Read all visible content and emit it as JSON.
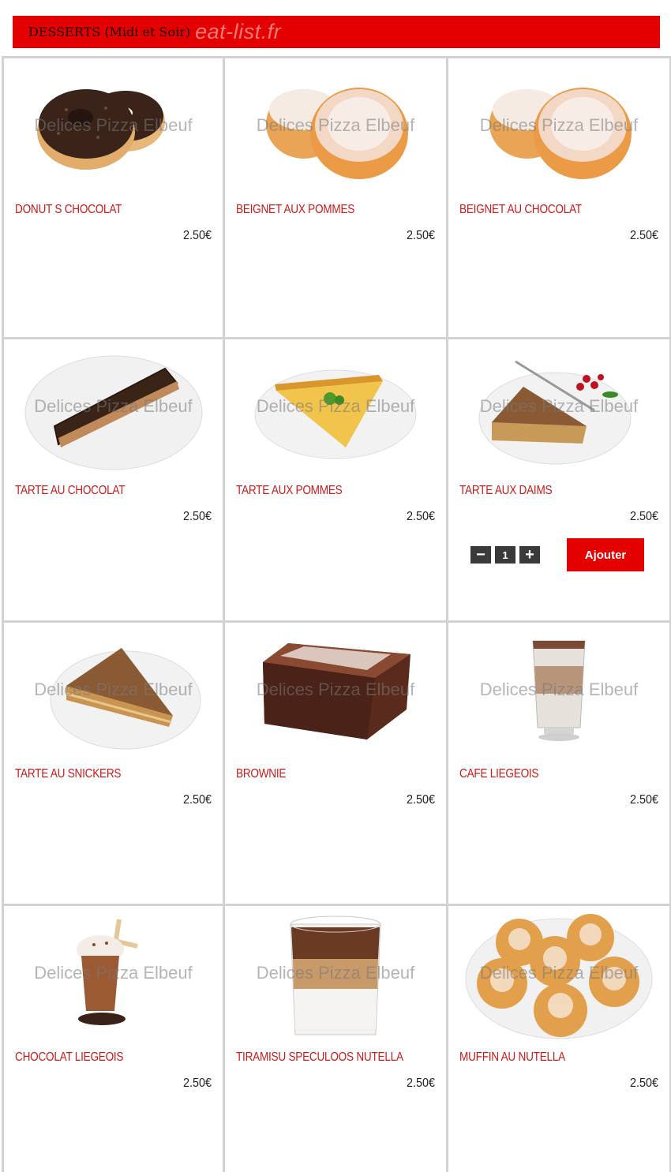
{
  "header": {
    "title": "DESSERTS (Midi et Soir)",
    "watermark": "eat-list.fr"
  },
  "watermark_text": "Delices Pizza Elbeuf",
  "products": [
    {
      "name": "DONUT S CHOCOLAT",
      "price": "2.50€",
      "image": "donut-chocolate"
    },
    {
      "name": "BEIGNET AUX POMMES",
      "price": "2.50€",
      "image": "sugar-beignet"
    },
    {
      "name": "BEIGNET AU CHOCOLAT",
      "price": "2.50€",
      "image": "sugar-beignet"
    },
    {
      "name": "TARTE AU CHOCOLAT",
      "price": "2.50€",
      "image": "chocolate-tart-slice"
    },
    {
      "name": "TARTE AUX POMMES",
      "price": "2.50€",
      "image": "apple-tart-slice"
    },
    {
      "name": "TARTE AUX DAIMS",
      "price": "2.50€",
      "image": "daim-tart-slice",
      "quantity": "1",
      "add_label": "Ajouter"
    },
    {
      "name": "TARTE AU SNICKERS",
      "price": "2.50€",
      "image": "snickers-tart-slice"
    },
    {
      "name": "BROWNIE",
      "price": "2.50€",
      "image": "brownie"
    },
    {
      "name": "CAFE LIEGEOIS",
      "price": "2.50€",
      "image": "latte-glass"
    },
    {
      "name": "CHOCOLAT LIEGEOIS",
      "price": "2.50€",
      "image": "chocolate-drink"
    },
    {
      "name": "TIRAMISU SPECULOOS NUTELLA",
      "price": "2.50€",
      "image": "tiramisu-glass"
    },
    {
      "name": "MUFFIN AU NUTELLA",
      "price": "2.50€",
      "image": "madeleines-plate"
    }
  ],
  "colors": {
    "accent": "#e50000",
    "product_name": "#cc1a1a",
    "border": "#d2d2d2",
    "qty_button": "#3a3a3a"
  }
}
